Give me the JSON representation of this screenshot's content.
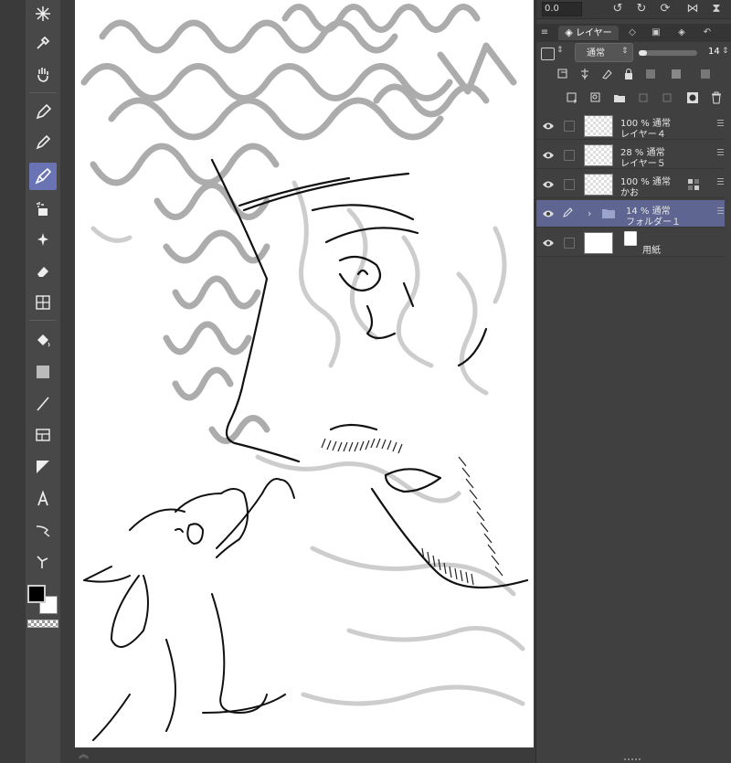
{
  "toolbar": {
    "tools": [
      {
        "icon": "sparkle-icon",
        "active": false
      },
      {
        "icon": "eyedropper-icon",
        "active": false
      },
      {
        "icon": "hand-icon",
        "active": false
      },
      {
        "icon": "pen-icon",
        "active": false
      },
      {
        "icon": "pencil-icon",
        "active": false
      },
      {
        "icon": "brush-icon",
        "active": true
      },
      {
        "icon": "airbrush-icon",
        "active": false
      },
      {
        "icon": "decoration-icon",
        "active": false
      },
      {
        "icon": "eraser-icon",
        "active": false
      },
      {
        "icon": "blend-icon",
        "active": false
      },
      {
        "icon": "fill-icon",
        "active": false
      },
      {
        "icon": "gradient-icon",
        "active": false
      },
      {
        "icon": "line-icon",
        "active": false
      },
      {
        "icon": "frame-icon",
        "active": false
      },
      {
        "icon": "ruler-icon",
        "active": false
      },
      {
        "icon": "text-icon",
        "active": false
      },
      {
        "icon": "balloon-icon",
        "active": false
      },
      {
        "icon": "correct-line-icon",
        "active": false
      }
    ],
    "foreground_color": "#000000",
    "background_color": "#ffffff"
  },
  "navigator": {
    "zoom": "0.0"
  },
  "layer_panel": {
    "tab_label": "レイヤー",
    "blend_mode": "通常",
    "opacity_value": "14",
    "opacity_fraction": 0.14,
    "accent_color": "#5d6590",
    "layers": [
      {
        "opacity_mode": "100 % 通常",
        "name": "レイヤー４",
        "type": "raster",
        "selected": false
      },
      {
        "opacity_mode": "28 % 通常",
        "name": "レイヤー５",
        "type": "raster",
        "selected": false
      },
      {
        "opacity_mode": "100 % 通常",
        "name": "かお",
        "type": "raster",
        "selected": false
      },
      {
        "opacity_mode": "14 % 通常",
        "name": "フォルダー１",
        "type": "folder",
        "selected": true
      },
      {
        "opacity_mode": "",
        "name": "用紙",
        "type": "paper",
        "selected": false
      }
    ]
  }
}
